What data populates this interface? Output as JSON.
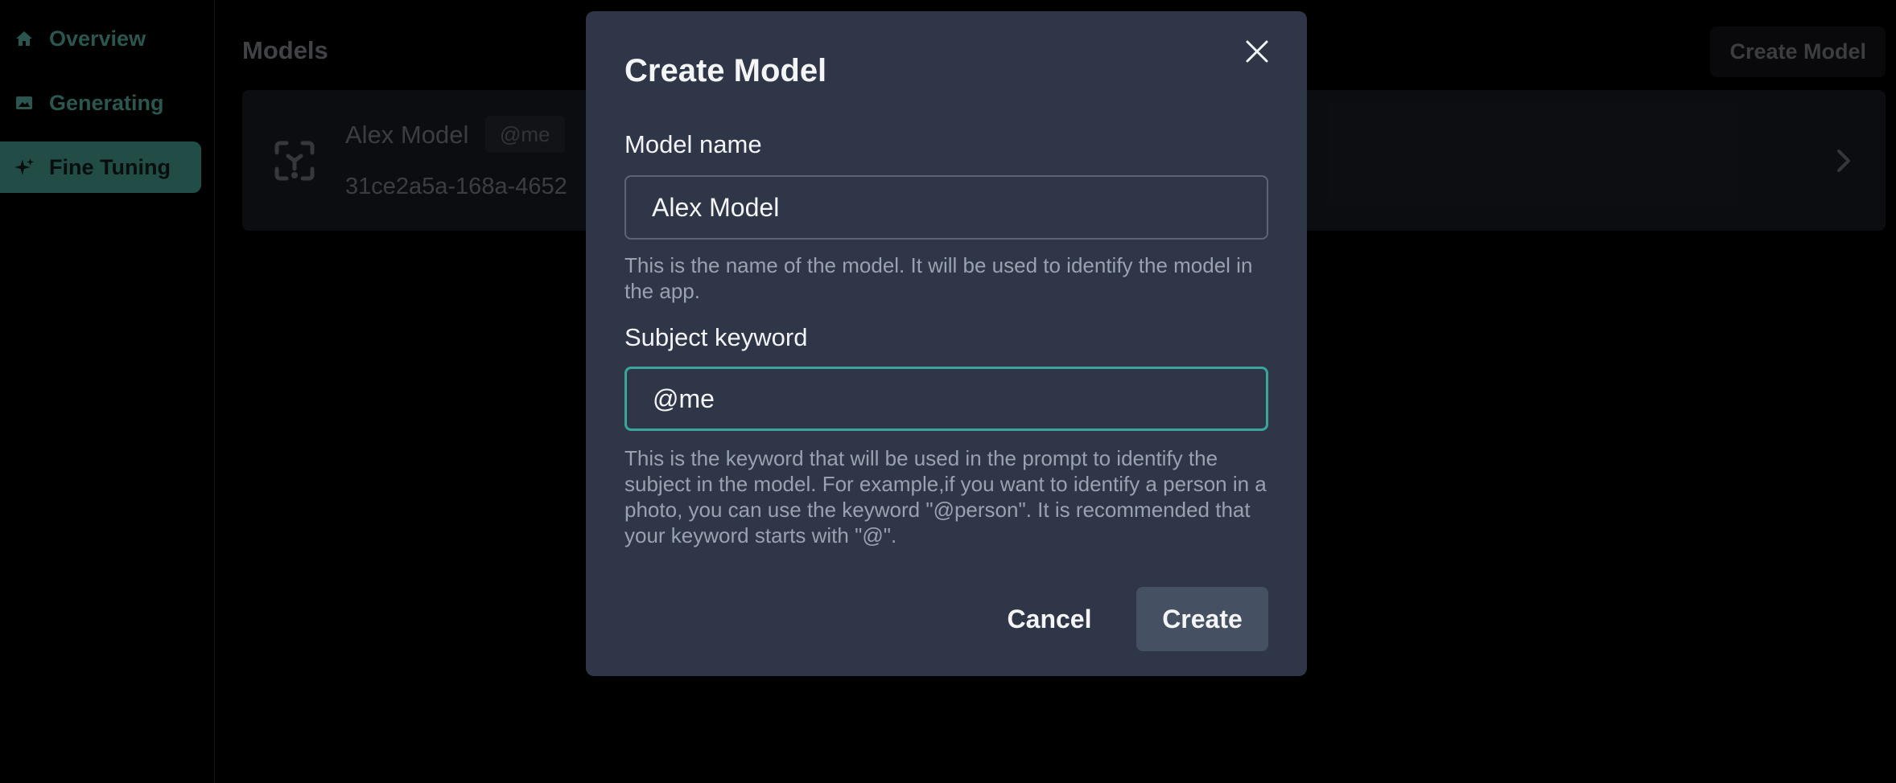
{
  "sidebar": {
    "items": [
      {
        "label": "Overview",
        "icon": "home-icon",
        "active": false
      },
      {
        "label": "Generating",
        "icon": "image-icon",
        "active": false
      },
      {
        "label": "Fine Tuning",
        "icon": "sparkles-icon",
        "active": true
      }
    ]
  },
  "main": {
    "title": "Models",
    "create_button": "Create Model",
    "models": [
      {
        "name": "Alex Model",
        "keyword": "@me",
        "id": "31ce2a5a-168a-4652"
      }
    ]
  },
  "modal": {
    "title": "Create Model",
    "model_name": {
      "label": "Model name",
      "value": "Alex Model",
      "help": "This is the name of the model. It will be used to identify the model in the app."
    },
    "subject_keyword": {
      "label": "Subject keyword",
      "value": "@me",
      "help": "This is the keyword that will be used in the prompt to identify the subject in the model. For example,if you want to identify a person in a photo, you can use the keyword \"@person\". It is recommended that your keyword starts with \"@\"."
    },
    "cancel_label": "Cancel",
    "create_label": "Create"
  },
  "colors": {
    "accent": "#3aa69b",
    "sidebar_active_bg": "#3f8a80",
    "modal_bg": "#2e3647"
  }
}
